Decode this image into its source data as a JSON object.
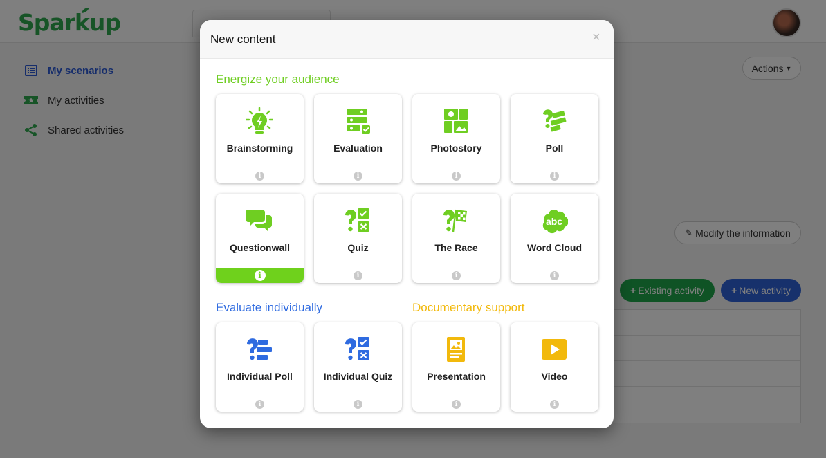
{
  "app": {
    "logo_text": "Sparkup",
    "brand_color": "#2fa84f",
    "accent_green": "#6fce22",
    "accent_blue": "#2f6be0",
    "accent_yellow": "#f2b90c"
  },
  "sidebar": {
    "items": [
      {
        "label": "My scenarios",
        "icon": "list-icon",
        "active": true
      },
      {
        "label": "My activities",
        "icon": "ticket-star-icon",
        "active": false
      },
      {
        "label": "Shared activities",
        "icon": "share-icon",
        "active": false
      }
    ]
  },
  "main": {
    "actions_label": "Actions",
    "modify_label": "Modify the information",
    "existing_activity_label": "Existing activity",
    "new_activity_label": "New activity"
  },
  "modal": {
    "title": "New content",
    "close_glyph": "×",
    "info_glyph": "i",
    "sections": [
      {
        "title": "Energize your audience",
        "color": "#6fce22",
        "cards": [
          {
            "label": "Brainstorming",
            "icon": "lightbulb-icon"
          },
          {
            "label": "Evaluation",
            "icon": "evaluation-icon"
          },
          {
            "label": "Photostory",
            "icon": "photostory-icon"
          },
          {
            "label": "Poll",
            "icon": "poll-icon"
          },
          {
            "label": "Questionwall",
            "icon": "speech-bubbles-icon",
            "hovered": true
          },
          {
            "label": "Quiz",
            "icon": "quiz-icon"
          },
          {
            "label": "The Race",
            "icon": "race-flag-icon"
          },
          {
            "label": "Word Cloud",
            "icon": "word-cloud-icon",
            "icon_text": "abc"
          }
        ]
      },
      {
        "title": "Evaluate individually",
        "color": "#2f6be0",
        "cards": [
          {
            "label": "Individual Poll",
            "icon": "individual-poll-icon"
          },
          {
            "label": "Individual Quiz",
            "icon": "individual-quiz-icon"
          }
        ]
      },
      {
        "title": "Documentary support",
        "color": "#f2b90c",
        "cards": [
          {
            "label": "Presentation",
            "icon": "presentation-icon"
          },
          {
            "label": "Video",
            "icon": "video-play-icon"
          }
        ]
      }
    ]
  }
}
